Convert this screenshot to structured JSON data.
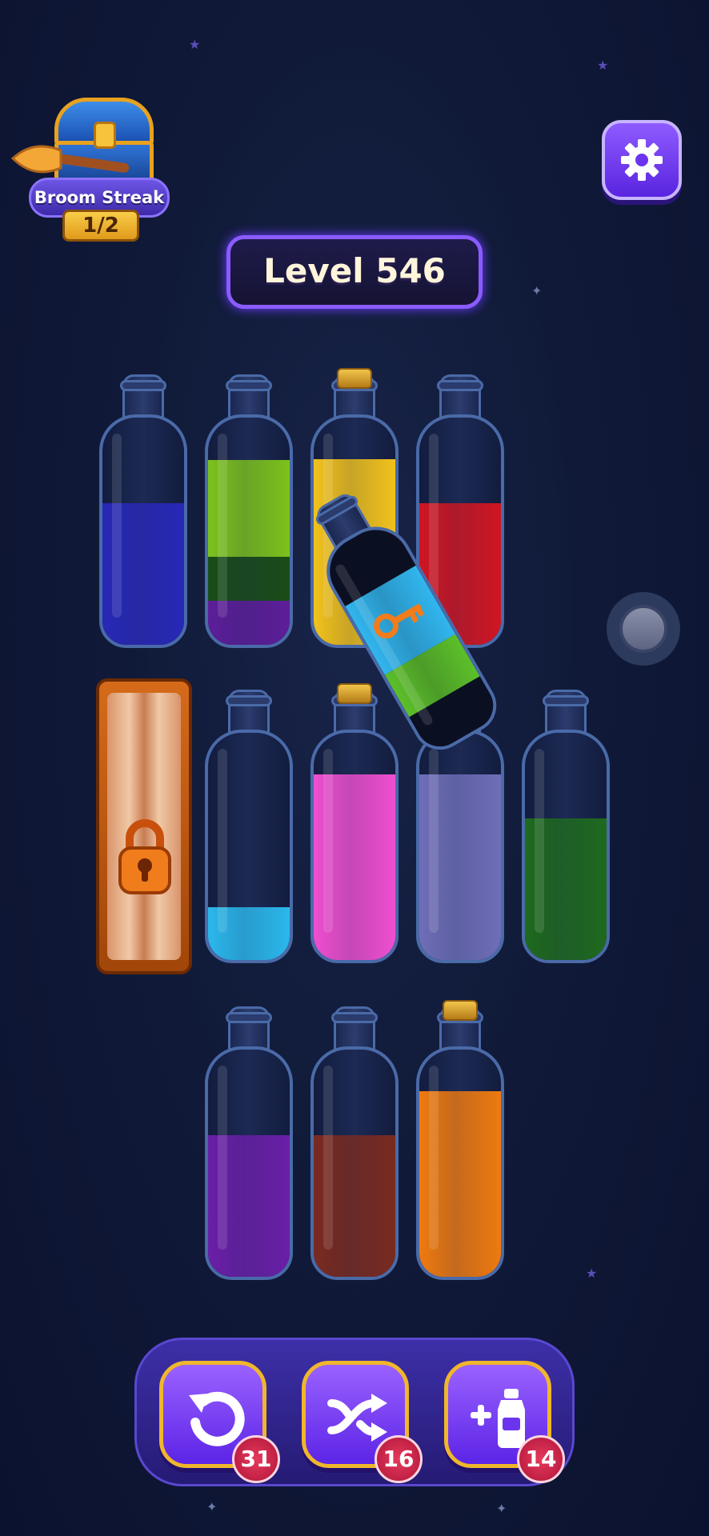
{
  "streak": {
    "label": "Broom Streak",
    "count": "1/2"
  },
  "level": {
    "label": "Level 546"
  },
  "bottles": [
    {
      "name": "bottle-1",
      "cork": false,
      "layers": [
        {
          "color": "#2828b8",
          "fraction": 0.64
        }
      ]
    },
    {
      "name": "bottle-2",
      "cork": false,
      "layers": [
        {
          "color": "#5d1e9a",
          "fraction": 0.2
        },
        {
          "color": "#1a4d18",
          "fraction": 0.2
        },
        {
          "color": "#7dc21c",
          "fraction": 0.44
        }
      ]
    },
    {
      "name": "bottle-3",
      "cork": true,
      "layers": [
        {
          "color": "#f2c21c",
          "fraction": 0.84
        }
      ]
    },
    {
      "name": "bottle-4",
      "cork": false,
      "layers": [
        {
          "color": "#d01623",
          "fraction": 0.64
        }
      ]
    },
    {
      "name": "bottle-6",
      "cork": false,
      "layers": [
        {
          "color": "#2bb8ec",
          "fraction": 0.24
        }
      ]
    },
    {
      "name": "bottle-7",
      "cork": true,
      "layers": [
        {
          "color": "#ef4fd0",
          "fraction": 0.84
        }
      ]
    },
    {
      "name": "bottle-8",
      "cork": true,
      "layers": [
        {
          "color": "#6f6eb8",
          "fraction": 0.84
        }
      ]
    },
    {
      "name": "bottle-9",
      "cork": false,
      "layers": [
        {
          "color": "#1f6a1e",
          "fraction": 0.64
        }
      ]
    },
    {
      "name": "bottle-10",
      "cork": false,
      "layers": [
        {
          "color": "#6a1fa8",
          "fraction": 0.64
        }
      ]
    },
    {
      "name": "bottle-11",
      "cork": false,
      "layers": [
        {
          "color": "#7a2a20",
          "fraction": 0.64
        }
      ]
    },
    {
      "name": "bottle-12",
      "cork": true,
      "layers": [
        {
          "color": "#ef7a10",
          "fraction": 0.84
        }
      ]
    }
  ],
  "tilted_bottle": {
    "layers": [
      {
        "color": "#0b0f22",
        "fraction": 0.2
      },
      {
        "color": "#5cbf2a",
        "fraction": 0.22
      },
      {
        "color": "#31b6ee",
        "fraction": 0.36
      }
    ]
  },
  "tools": {
    "undo": {
      "icon": "undo-icon",
      "count": "31"
    },
    "shuffle": {
      "icon": "shuffle-icon",
      "count": "16"
    },
    "add_bottle": {
      "icon": "add-bottle-icon",
      "count": "14"
    }
  }
}
